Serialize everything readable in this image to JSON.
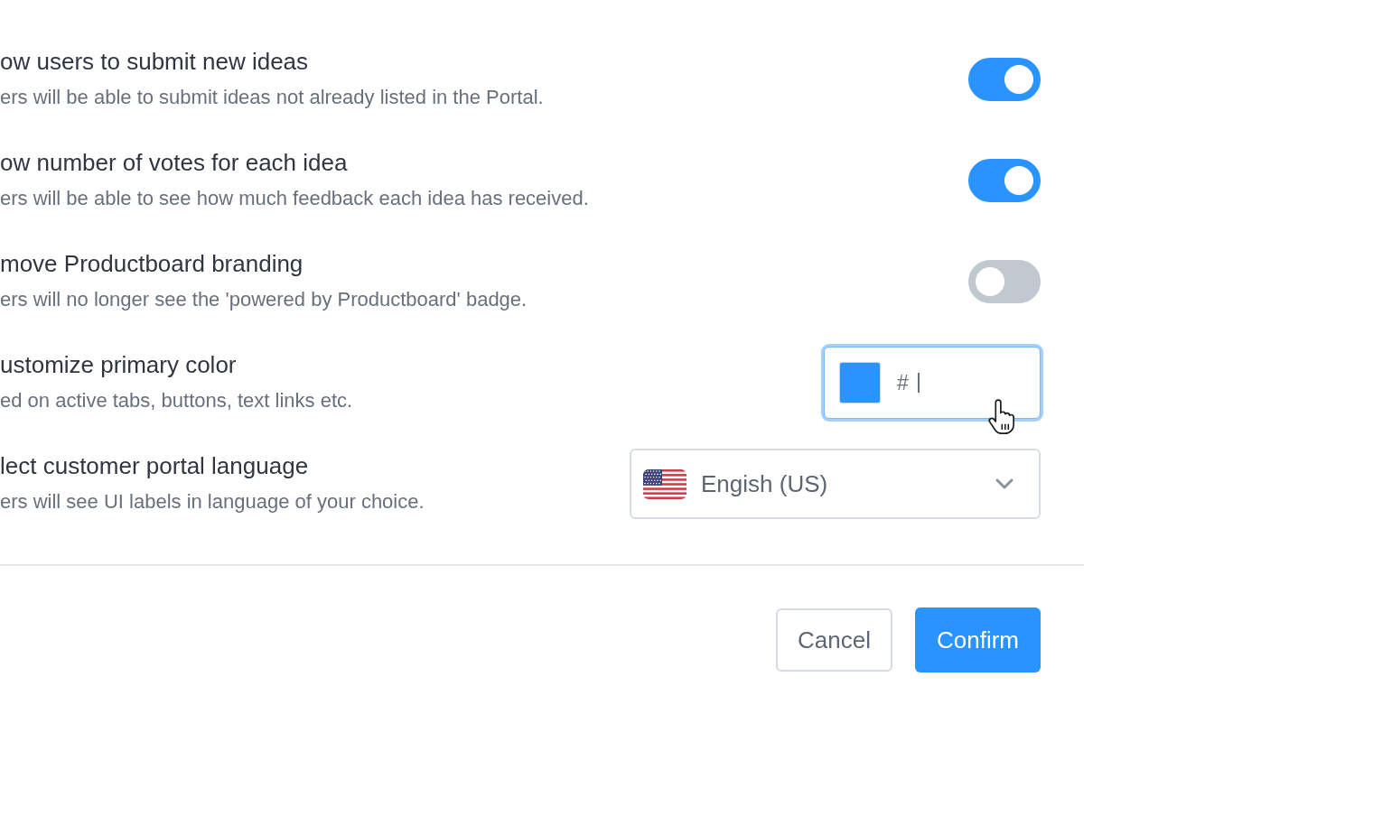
{
  "settings": [
    {
      "kind": "toggle",
      "title": "ow users to submit new ideas",
      "description": "ers will be able to submit ideas not already listed in the Portal.",
      "on": true
    },
    {
      "kind": "toggle",
      "title": "ow number of votes for each idea",
      "description": "ers will be able to see how much feedback each idea has received.",
      "on": true
    },
    {
      "kind": "toggle",
      "title": "move Productboard branding",
      "description": "ers will no longer see the 'powered by Productboard' badge.",
      "on": false
    },
    {
      "kind": "color",
      "title": "ustomize primary color",
      "description": "ed on active tabs, buttons, text links etc.",
      "color": "#2994ff",
      "prefix": "#",
      "focused": true
    },
    {
      "kind": "select",
      "title": "lect customer portal language",
      "description": "ers will see UI labels in language of your choice.",
      "value": "Engish (US)"
    }
  ],
  "buttons": [
    {
      "kind": "secondary",
      "label": "Cancel"
    },
    {
      "kind": "primary",
      "label": "Confirm"
    }
  ]
}
